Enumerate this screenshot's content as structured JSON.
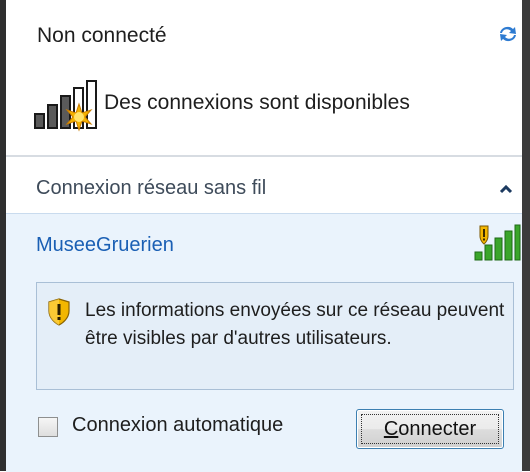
{
  "header": {
    "status_title": "Non connecté",
    "refresh_icon": "refresh-arrows-icon"
  },
  "availability": {
    "text": "Des connexions sont disponibles",
    "icon": "wireless-available-icon"
  },
  "section": {
    "title": "Connexion réseau sans fil",
    "toggle_icon": "chevron-up-icon"
  },
  "network": {
    "name": "MuseeGruerien",
    "signal_icon": "wifi-signal-unsecured-icon",
    "warning_icon": "security-shield-icon",
    "warning_text": "Les informations envoyées sur ce réseau peuvent être visibles par d'autres utilisateurs.",
    "auto_connect_label": "Connexion automatique",
    "auto_connect_checked": false,
    "connect_button_rest": "onnecter",
    "connect_button_mnemonic": "C"
  },
  "colors": {
    "link_blue": "#1a5fb4",
    "panel_bg": "#eaf3fc",
    "warning_bg": "#e4eef8",
    "signal_green": "#3aa52a",
    "shield_yellow": "#f2b600"
  }
}
